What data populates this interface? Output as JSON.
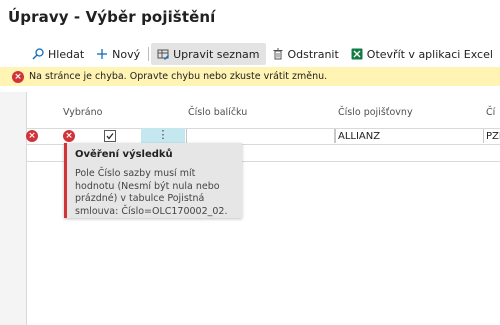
{
  "page": {
    "title": "Úpravy - Výběr pojištění"
  },
  "toolbar": {
    "search": "Hledat",
    "new": "Nový",
    "edit_list": "Upravit seznam",
    "delete": "Odstranit",
    "open_excel": "Otevřít v aplikaci Excel"
  },
  "error_bar": {
    "message": "Na stránce je chyba. Opravte chybu nebo zkuste vrátit změnu."
  },
  "columns": {
    "selected": "Vybráno",
    "package_number": "Číslo balíčku",
    "insurer_number": "Číslo pojišťovny",
    "partial": "Čí"
  },
  "row": {
    "selected": true,
    "dots": "⋮",
    "insurer": "ALLIANZ",
    "partial": "PZP"
  },
  "tooltip": {
    "title": "Ověření výsledků",
    "body": "Pole Číslo sazby musí mít hodnotu (Nesmí být nula nebo prázdné) v tabulce Pojistná smlouva: Číslo=OLC170002_02."
  },
  "colors": {
    "error": "#d13438",
    "warning_bg": "#fff4b3",
    "selected_cell": "#c5e8f0"
  }
}
